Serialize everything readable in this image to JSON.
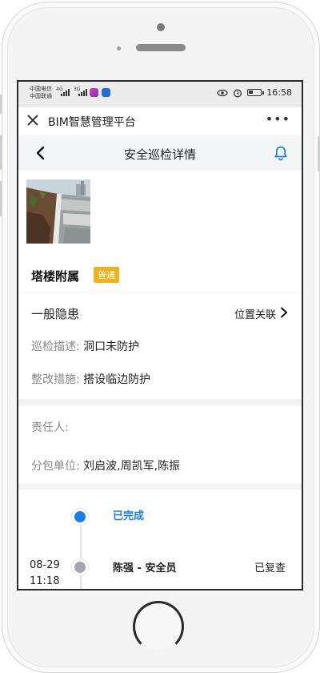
{
  "status_bar": {
    "carrier_1": "中国电信",
    "carrier_2": "中国联通",
    "net_1": "4G",
    "net_2": "3G",
    "time": "16:58",
    "battery_level": 0.4
  },
  "wechat_bar": {
    "title": "BIM智慧管理平台",
    "more": "•••"
  },
  "header": {
    "title": "安全巡检详情"
  },
  "issue": {
    "title": "塔楼附属",
    "badge": "普通",
    "badge_color": "#f1b11b",
    "level": "一般隐患",
    "location_link": "位置关联",
    "desc_label": "巡检描述:",
    "desc_value": "洞口未防护",
    "measure_label": "整改措施:",
    "measure_value": "搭设临边防护"
  },
  "assignment": {
    "owner_label": "责任人:",
    "owner_value": "",
    "sub_label": "分包单位:",
    "sub_value": "刘启波,周凯军,陈振"
  },
  "timeline": {
    "status": "已完成",
    "accent": "#1a7cf0",
    "date": "08-29",
    "time": "11:18",
    "person": "陈强 - 安全员",
    "result": "已复查"
  },
  "icons": {
    "back": "chevron-left-icon",
    "bell": "bell-icon",
    "close": "close-icon",
    "chevron": "chevron-right-icon"
  }
}
